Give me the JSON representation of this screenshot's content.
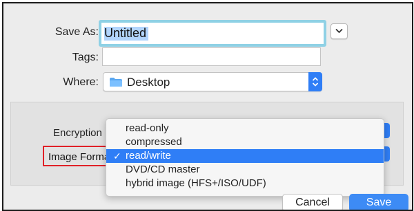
{
  "dialog": {
    "save_as_label": "Save As:",
    "save_as_value": "Untitled",
    "tags_label": "Tags:",
    "tags_value": "",
    "where_label": "Where:",
    "where_value": "Desktop"
  },
  "options": {
    "encryption_label": "Encryption",
    "image_format_label": "Image Forma",
    "image_format_menu": [
      {
        "label": "read-only",
        "selected": false
      },
      {
        "label": "compressed",
        "selected": false
      },
      {
        "label": "read/write",
        "selected": true
      },
      {
        "label": "DVD/CD master",
        "selected": false
      },
      {
        "label": "hybrid image (HFS+/ISO/UDF)",
        "selected": false
      }
    ],
    "check_glyph": "✓"
  },
  "buttons": {
    "cancel_label": "Cancel",
    "save_label": "Save"
  },
  "colors": {
    "accent": "#2f7ef6",
    "focus_ring": "#8fd1e5",
    "highlight_box": "#e02027"
  }
}
